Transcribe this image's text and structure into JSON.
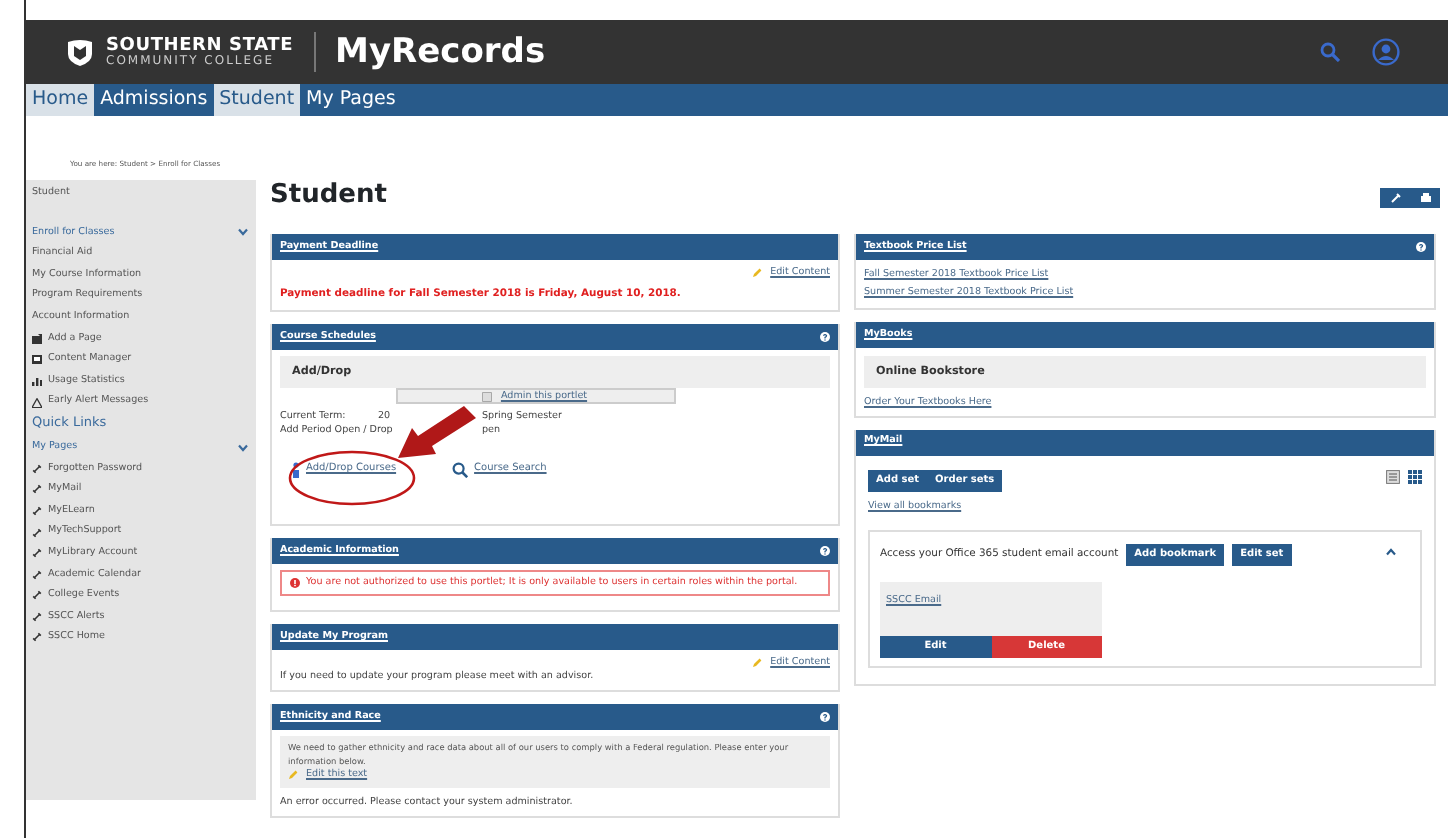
{
  "header": {
    "logo_line1": "SOUTHERN STATE",
    "logo_line2": "COMMUNITY COLLEGE",
    "app_title": "MyRecords"
  },
  "nav": [
    {
      "label": "Home",
      "selected": true
    },
    {
      "label": "Admissions",
      "selected": false
    },
    {
      "label": "Student",
      "selected": true
    },
    {
      "label": "My Pages",
      "selected": false
    }
  ],
  "breadcrumb": {
    "prefix": "You are here:",
    "links": [
      "Student",
      "Enroll for Classes"
    ],
    "separator": ">"
  },
  "sidebar": {
    "heading": "Student",
    "items": [
      {
        "label": "Enroll for Classes",
        "kind": "group",
        "expanded": true
      },
      {
        "label": "Financial Aid",
        "kind": "plain"
      },
      {
        "label": "My Course Information",
        "kind": "plain"
      },
      {
        "label": "Program Requirements",
        "kind": "plain"
      },
      {
        "label": "Account Information",
        "kind": "plain"
      },
      {
        "label": "Add a Page",
        "kind": "page"
      },
      {
        "label": "Content Manager",
        "kind": "manager"
      },
      {
        "label": "Usage Statistics",
        "kind": "stats"
      },
      {
        "label": "Early Alert Messages",
        "kind": "alert"
      },
      {
        "label": "Quick Links",
        "kind": "title"
      },
      {
        "label": "My Pages",
        "kind": "group",
        "expanded": true
      },
      {
        "label": "Forgotten Password",
        "kind": "link"
      },
      {
        "label": "MyMail",
        "kind": "link"
      },
      {
        "label": "MyELearn",
        "kind": "link"
      },
      {
        "label": "MyTechSupport",
        "kind": "link"
      },
      {
        "label": "MyLibrary Account",
        "kind": "link"
      },
      {
        "label": "Academic Calendar",
        "kind": "link"
      },
      {
        "label": "College Events",
        "kind": "link"
      },
      {
        "label": "SSCC Alerts",
        "kind": "link"
      },
      {
        "label": "SSCC Home",
        "kind": "link"
      }
    ]
  },
  "page_title": "Student",
  "left_portlets": [
    {
      "kind": "notice",
      "title": "Payment Deadline",
      "help": false,
      "edit_link": "Edit Content",
      "message": "Payment deadline for Fall Semester 2018 is Friday, August 10, 2018."
    },
    {
      "kind": "schedule",
      "title": "Course Schedules",
      "help": true,
      "subheader": "Add/Drop",
      "admin_link": "Admin this portlet",
      "term_label": "Current Term:",
      "term_start": "20",
      "term_end": "Spring Semester",
      "period_start": "Add Period Open / Drop",
      "period_end": "pen",
      "links": [
        "Add/Drop Courses",
        "Course Search"
      ]
    },
    {
      "kind": "error",
      "title": "Academic Information",
      "help": true,
      "message": "You are not authorized to use this portlet; It is only available to users in certain roles within the portal."
    },
    {
      "kind": "text",
      "title": "Update My Program",
      "help": false,
      "edit_link": "Edit Content",
      "text": "If you need to update your program please meet with an advisor."
    },
    {
      "kind": "info",
      "title": "Ethnicity and Race",
      "help": true,
      "info": "We need to gather ethnicity and race data about all of our users to comply with a Federal regulation. Please enter your information below.",
      "edit_link": "Edit this text",
      "text": "An error occurred. Please contact your system administrator."
    }
  ],
  "right_portlets": [
    {
      "kind": "links",
      "title": "Textbook Price List",
      "help": true,
      "links": [
        "Fall Semester 2018 Textbook Price List",
        "Summer Semester 2018 Textbook Price List"
      ]
    },
    {
      "kind": "bookstore",
      "title": "MyBooks",
      "help": false,
      "subheader": "Online Bookstore",
      "link": "Order Your Textbooks Here"
    },
    {
      "kind": "bookmarks",
      "title": "MyMail",
      "help": false,
      "buttons": [
        "Add set",
        "Order sets"
      ],
      "link": "View all bookmarks",
      "set": {
        "title": "Access your Office 365 student email account",
        "buttons": [
          "Add bookmark",
          "Edit set"
        ],
        "expanded": true,
        "bookmark": "SSCC Email",
        "edit": "Edit",
        "delete": "Delete"
      }
    }
  ]
}
